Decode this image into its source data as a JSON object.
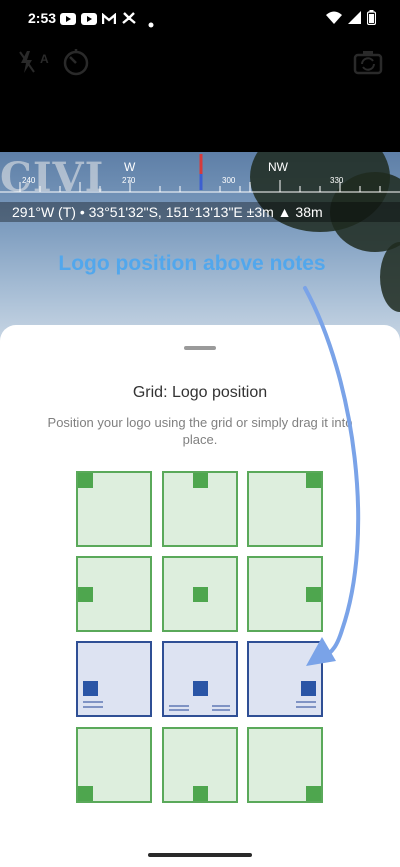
{
  "status_bar": {
    "time": "2:53",
    "left_icons": [
      "youtube-icon",
      "youtube-icon",
      "gmail-icon",
      "fan-icon",
      "dot-icon"
    ],
    "right_icons": [
      "wifi-icon",
      "signal-icon",
      "battery-icon"
    ]
  },
  "toolbar": {
    "flash_label": "A",
    "icons": [
      "flash-auto-icon",
      "timer-icon",
      "switch-camera-icon"
    ]
  },
  "camera_preview": {
    "overlay_text": "CIVI",
    "compass": {
      "labels": [
        "W",
        "NW"
      ],
      "degrees": [
        "240",
        "270",
        "300",
        "330"
      ]
    },
    "gps_readout": "291°W (T) • 33°51'32\"S, 151°13'13\"E ±3m ▲ 38m",
    "annotation": "Logo position above notes"
  },
  "sheet": {
    "title": "Grid: Logo position",
    "description": "Position your logo using the grid or simply drag it into place.",
    "grid": [
      {
        "row": "top",
        "col": "left",
        "style": "green",
        "has_notes": false
      },
      {
        "row": "top",
        "col": "center",
        "style": "green",
        "has_notes": false
      },
      {
        "row": "top",
        "col": "right",
        "style": "green",
        "has_notes": false
      },
      {
        "row": "middle",
        "col": "left",
        "style": "green",
        "has_notes": false
      },
      {
        "row": "middle",
        "col": "center",
        "style": "green",
        "has_notes": false
      },
      {
        "row": "middle",
        "col": "right",
        "style": "green",
        "has_notes": false
      },
      {
        "row": "above-notes",
        "col": "left",
        "style": "blue",
        "has_notes": true
      },
      {
        "row": "above-notes",
        "col": "center",
        "style": "blue",
        "has_notes": true
      },
      {
        "row": "above-notes",
        "col": "right",
        "style": "blue",
        "has_notes": true
      },
      {
        "row": "bottom",
        "col": "left",
        "style": "green",
        "has_notes": false
      },
      {
        "row": "bottom",
        "col": "center",
        "style": "green",
        "has_notes": false
      },
      {
        "row": "bottom",
        "col": "right",
        "style": "green",
        "has_notes": false
      }
    ]
  },
  "colors": {
    "green_fill": "#ddeedd",
    "green_border": "#5aa95a",
    "blue_fill": "#dde3f2",
    "blue_border": "#2f4f95",
    "annotation": "#52a7ec",
    "arrow": "#7aa3e8"
  }
}
